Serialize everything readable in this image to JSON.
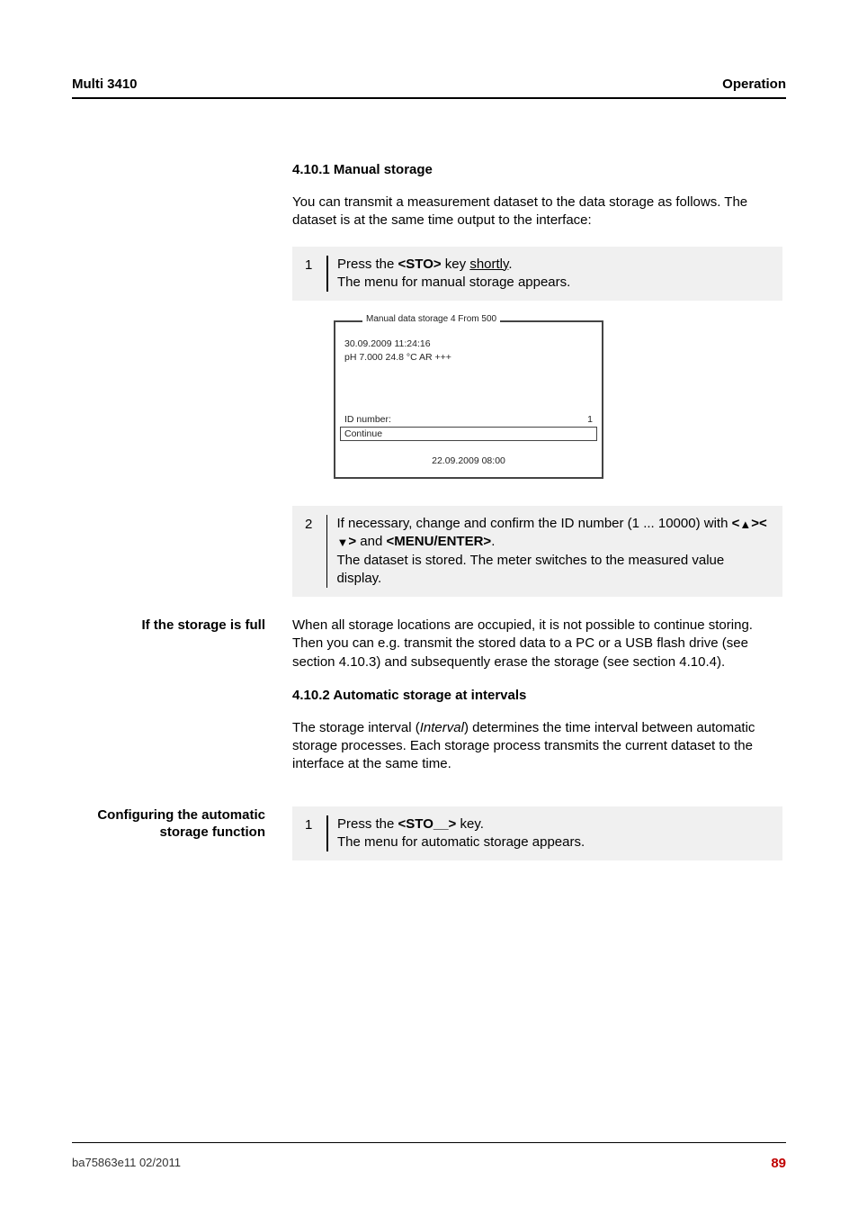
{
  "header": {
    "left": "Multi 3410",
    "right": "Operation"
  },
  "sec1": {
    "heading": "4.10.1  Manual storage",
    "intro": "You can transmit a measurement dataset to the data storage as follows. The dataset is at the same time output to the interface:",
    "step1_num": "1",
    "step1_a": "Press the ",
    "step1_key": "<STO>",
    "step1_b": " key ",
    "step1_shortly": "shortly",
    "step1_c": ".",
    "step1_line2": "The menu for manual storage appears.",
    "step2_num": "2",
    "step2_a": "If necessary, change and confirm the ID number (1 ... 10000) with ",
    "step2_keys1": "<",
    "step2_keys2": "><",
    "step2_keys3": ">",
    "step2_b": " and ",
    "step2_menu": "<MENU/ENTER>",
    "step2_c": ".",
    "step2_line2": "The dataset is stored. The meter switches to the measured value display."
  },
  "screen": {
    "title": "Manual data storage 4 From 500",
    "l1": "30.09.2009  11:24:16",
    "l2": "pH 7.000    24.8 °C  AR  +++",
    "id_label": "ID number:",
    "id_value": "1",
    "continue": "Continue",
    "footer": "22.09.2009 08:00"
  },
  "full": {
    "label": "If the storage is full",
    "text": "When all storage locations are occupied, it is not possible to continue storing. Then you can e.g. transmit the stored data to a PC or a USB flash drive (see section 4.10.3) and subsequently erase the storage (see section 4.10.4)."
  },
  "sec2": {
    "heading": "4.10.2  Automatic storage at intervals",
    "text_a": "The storage interval (",
    "text_interval": "Interval",
    "text_b": ") determines the time interval between automatic storage processes. Each storage process transmits the current dataset to the interface at the same time."
  },
  "config": {
    "label": "Configuring the automatic storage function",
    "step_num": "1",
    "step_a": "Press the ",
    "step_key": "<STO__>",
    "step_b": " key.",
    "step_line2": "The menu for automatic storage appears."
  },
  "footer": {
    "left": "ba75863e11     02/2011",
    "right": "89"
  },
  "glyph": {
    "up": "▲",
    "down": "▼"
  }
}
